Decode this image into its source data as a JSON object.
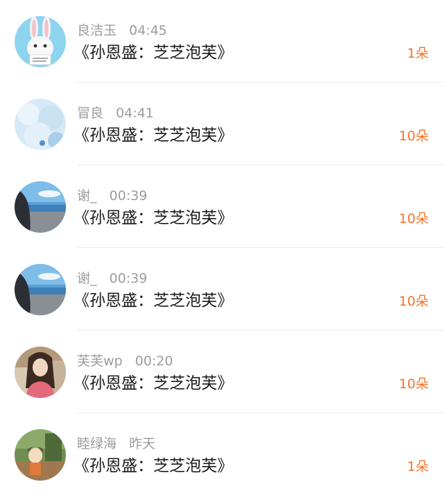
{
  "gifts": [
    {
      "user": "良洁玉",
      "time": "04:45",
      "title": "《孙恩盛：芝芝泡芙》",
      "count": "1朵",
      "avatar_icon": "white-bunny-avatar"
    },
    {
      "user": "冒良",
      "time": "04:41",
      "title": "《孙恩盛：芝芝泡芙》",
      "count": "10朵",
      "avatar_icon": "pale-blue-sky-avatar"
    },
    {
      "user": "谢_",
      "time": "00:39",
      "title": "《孙恩盛：芝芝泡芙》",
      "count": "10朵",
      "avatar_icon": "seaside-person-avatar"
    },
    {
      "user": "谢_",
      "time": "00:39",
      "title": "《孙恩盛：芝芝泡芙》",
      "count": "10朵",
      "avatar_icon": "seaside-person-avatar"
    },
    {
      "user": "芙芙wp",
      "time": "00:20",
      "title": "《孙恩盛：芝芝泡芙》",
      "count": "10朵",
      "avatar_icon": "girl-portrait-avatar"
    },
    {
      "user": "睦绿海",
      "time": "昨天",
      "title": "《孙恩盛：芝芝泡芙》",
      "count": "1朵",
      "avatar_icon": "anime-scene-avatar"
    }
  ],
  "colors": {
    "username": "#9c9c9c",
    "title": "#1a1a1a",
    "count_accent": "#f5732a",
    "divider": "#ececec"
  }
}
